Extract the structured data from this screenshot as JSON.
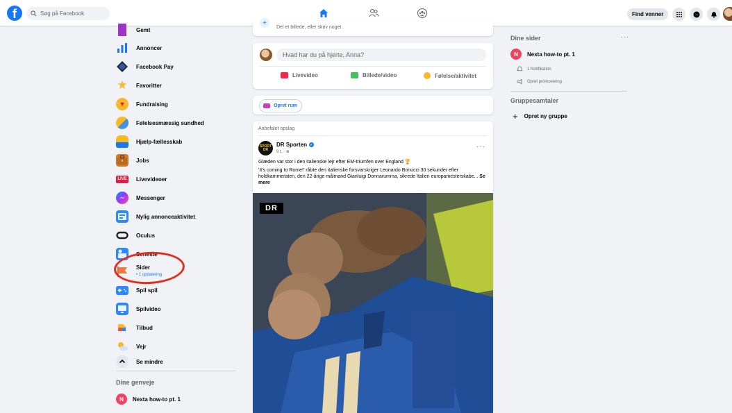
{
  "header": {
    "search_placeholder": "Søg på Facebook",
    "find_friends": "Find venner",
    "brand_color": "#1877f2"
  },
  "left_nav": {
    "items": [
      {
        "label": "Gemt",
        "icon": "bookmark-icon"
      },
      {
        "label": "Annoncer",
        "icon": "bar-chart-icon"
      },
      {
        "label": "Facebook Pay",
        "icon": "diamond-icon"
      },
      {
        "label": "Favoritter",
        "icon": "star-icon"
      },
      {
        "label": "Fundraising",
        "icon": "heart-icon"
      },
      {
        "label": "Følelsesmæssig sundhed",
        "icon": "cloud-icon"
      },
      {
        "label": "Hjælp-fællesskab",
        "icon": "helping-hand-icon"
      },
      {
        "label": "Jobs",
        "icon": "briefcase-icon"
      },
      {
        "label": "Livevideoer",
        "icon": "live-badge-icon",
        "badge": "LIVE"
      },
      {
        "label": "Messenger",
        "icon": "messenger-icon"
      },
      {
        "label": "Nylig annonceaktivitet",
        "icon": "ad-activity-icon"
      },
      {
        "label": "Oculus",
        "icon": "vr-headset-icon"
      },
      {
        "label": "Seneste",
        "icon": "clock-feed-icon"
      },
      {
        "label": "Sider",
        "icon": "flag-icon",
        "sub": "• 1 opdatering"
      },
      {
        "label": "Spil spil",
        "icon": "gamepad-icon"
      },
      {
        "label": "Spilvideo",
        "icon": "game-video-icon"
      },
      {
        "label": "Tilbud",
        "icon": "offer-tag-icon"
      },
      {
        "label": "Vejr",
        "icon": "weather-icon"
      },
      {
        "label": "Se mindre",
        "icon": "chevron-up-icon"
      }
    ],
    "shortcuts_heading": "Dine genveje",
    "shortcut": {
      "letter": "N",
      "name": "Nexta how-to pt. 1"
    }
  },
  "feed": {
    "story_hint": "Del et billede, eller skriv noget.",
    "composer_placeholder": "Hvad har du på hjerte, Anna?",
    "actions": {
      "live": "Livevideo",
      "photo": "Billede/video",
      "feeling": "Følelse/aktivitet"
    },
    "create_room": "Opret rum",
    "post": {
      "recommended": "Anbefalet opslag",
      "author": "DR Sporten",
      "verified_mark": "✔",
      "time": "9 t. · ⊕",
      "more_menu": "···",
      "text_line1": "Glæden var stor i den italienske lejr efter EM-triumfen over England 🏆",
      "text_body": "'It's coming to Rome!' råbte den italienske forsvarskriger Leonardo Bonucci 30 sekunder efter holdkammeraten, den 22-årige målmand Gianluigi Donnarumma, sikrede Italien europamesterskabe...",
      "see_more": "Se mere",
      "avatar_text": "SPORT DR",
      "image_logo": "DR"
    }
  },
  "right": {
    "pages_heading": "Dine sider",
    "more_menu": "···",
    "page": {
      "letter": "N",
      "name": "Nexta how-to pt. 1"
    },
    "notification": "1 Notifikation",
    "promotion": "Opret promovering",
    "groups_heading": "Gruppesamtaler",
    "create_group": "Opret ny gruppe"
  }
}
